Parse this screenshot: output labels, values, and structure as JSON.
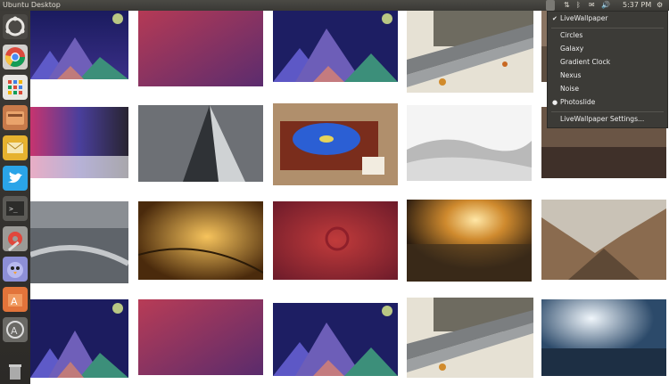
{
  "topbar": {
    "title": "Ubuntu Desktop",
    "time": "5:37 PM"
  },
  "launcher": {
    "items": [
      {
        "name": "dash-home",
        "icon": "ubuntu-logo-icon"
      },
      {
        "name": "chrome",
        "icon": "chrome-icon"
      },
      {
        "name": "apps",
        "icon": "apps-grid-icon"
      },
      {
        "name": "files",
        "icon": "file-manager-icon"
      },
      {
        "name": "mail",
        "icon": "mail-icon"
      },
      {
        "name": "twitter",
        "icon": "twitter-icon"
      },
      {
        "name": "terminal",
        "icon": "terminal-icon"
      },
      {
        "name": "settings",
        "icon": "settings-icon"
      },
      {
        "name": "pidgin",
        "icon": "pidgin-bird-icon"
      },
      {
        "name": "software-center",
        "icon": "software-center-icon"
      },
      {
        "name": "updater",
        "icon": "updater-icon"
      },
      {
        "name": "trash",
        "icon": "trash-icon"
      }
    ]
  },
  "indicator_menu": {
    "header": "LiveWallpaper",
    "items": [
      "Circles",
      "Galaxy",
      "Gradient Clock",
      "Nexus",
      "Noise",
      "Photoslide"
    ],
    "selected": "Photoslide",
    "settings": "LiveWallpaper Settings..."
  },
  "wallpapers": [
    [
      "mountain-triangles",
      "purple-gradient",
      "mountain-triangles",
      "bench-leaves",
      "wallpaper"
    ],
    [
      "cobblestones",
      "skyscraper",
      "record-player",
      "desert-dunes",
      "wallpaper"
    ],
    [
      "rope-knit",
      "autumn-leaf",
      "ubuntu-red-logo",
      "sunset-field",
      "valley"
    ],
    [
      "mountain-triangles",
      "purple-gradient",
      "mountain-triangles",
      "bench-leaves",
      "lake-moon"
    ]
  ]
}
